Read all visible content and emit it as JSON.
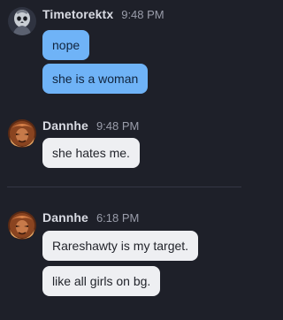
{
  "messages": [
    {
      "sender": "Timetorektx",
      "time": "9:48 PM",
      "avatar_icon": "skull-avatar-icon",
      "bubbles": [
        "nope",
        "she is a woman"
      ]
    },
    {
      "sender": "Dannhe",
      "time": "9:48 PM",
      "avatar_icon": "warrior-avatar-icon",
      "bubbles": [
        "she hates me."
      ]
    },
    {
      "sender": "Dannhe",
      "time": "6:18 PM",
      "avatar_icon": "warrior-avatar-icon",
      "bubbles": [
        "Rareshawty is my target.",
        "like all girls on bg."
      ]
    }
  ],
  "colors": {
    "background": "#1e2029",
    "own_bubble": "#6fb3f7",
    "other_bubble": "#eeeff2"
  }
}
